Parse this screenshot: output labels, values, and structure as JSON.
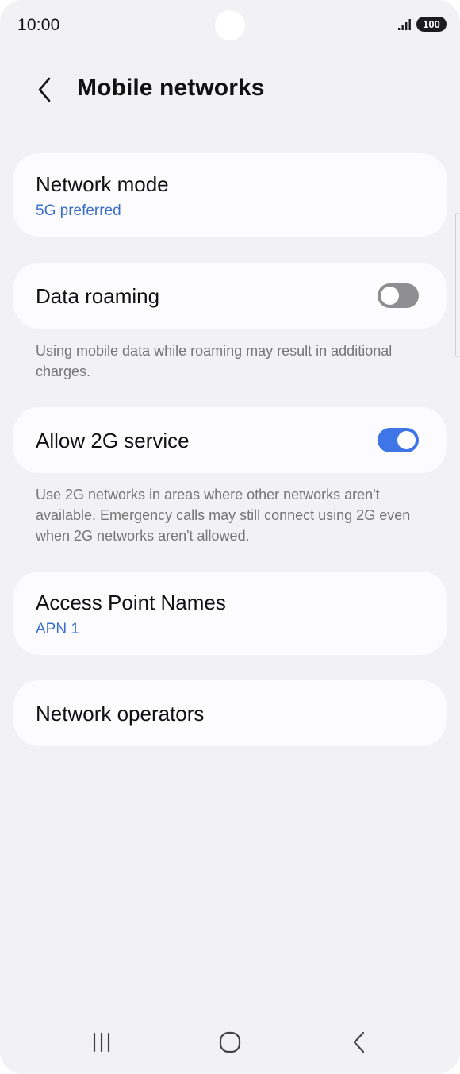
{
  "status_bar": {
    "time": "10:00",
    "battery": "100",
    "signal_icon": "signal-bars-icon"
  },
  "header": {
    "back_icon": "chevron-left-icon",
    "title": "Mobile networks"
  },
  "network_mode": {
    "title": "Network mode",
    "value": "5G preferred"
  },
  "data_roaming": {
    "title": "Data roaming",
    "enabled": false,
    "description": "Using mobile data while roaming may result in additional charges."
  },
  "allow_2g": {
    "title": "Allow 2G service",
    "enabled": true,
    "description": "Use 2G networks in areas where other networks aren't available. Emergency calls may still connect using 2G even when 2G networks aren't allowed."
  },
  "apn": {
    "title": "Access Point Names",
    "value": "APN 1"
  },
  "network_operators": {
    "title": "Network operators"
  },
  "nav_bar": {
    "recents_icon": "recents-icon",
    "home_icon": "home-icon",
    "back_icon": "back-icon"
  },
  "colors": {
    "accent": "#3e76e8",
    "link_text": "#3a6fc9",
    "background": "#f2f2f4",
    "card": "#fcfcfe",
    "toggle_off": "#8f8f91"
  }
}
